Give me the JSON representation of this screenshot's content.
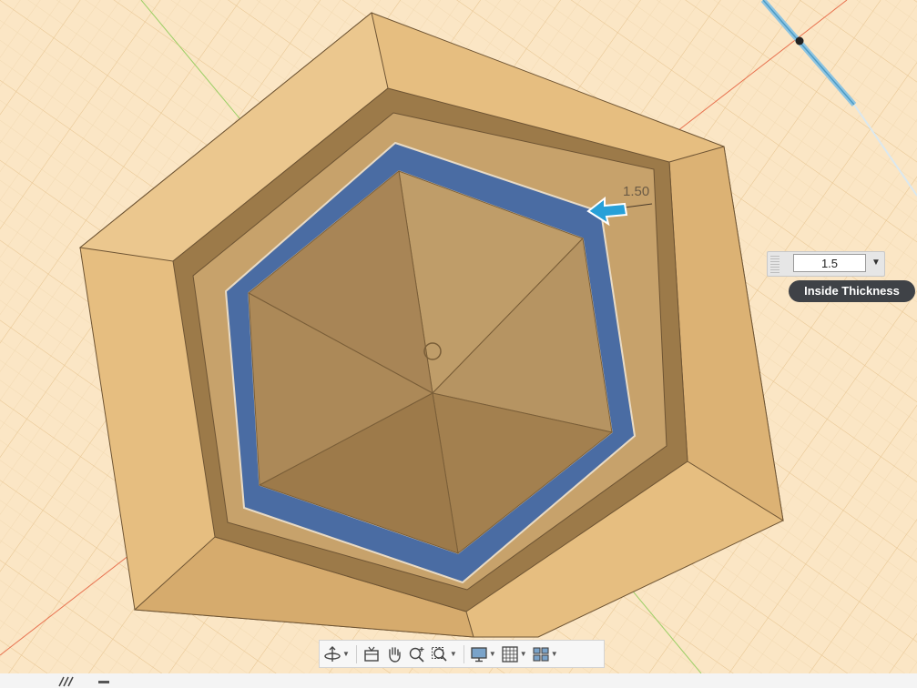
{
  "viewport": {
    "dimension_text": "1.50",
    "colors": {
      "background": "#fbe6c5",
      "grid": "#efd3a8",
      "outer_body": "#e6be80",
      "ledge": "#a07d4d",
      "shell_band": "#4a6ca3",
      "inner_floor": "#b18f5d",
      "x_axis": "#e8714f",
      "y_axis": "#9ccf66",
      "arrow": "#27a0d8"
    }
  },
  "thickness_input": {
    "value": "1.5",
    "tooltip": "Inside Thickness"
  },
  "nav_toolbar": {
    "tools": [
      {
        "id": "orbit",
        "icon": "orbit-icon",
        "has_menu": true
      },
      {
        "id": "look-at",
        "icon": "look-at-icon",
        "has_menu": false
      },
      {
        "id": "pan",
        "icon": "pan-hand-icon",
        "has_menu": false
      },
      {
        "id": "zoom",
        "icon": "zoom-icon",
        "has_menu": false
      },
      {
        "id": "zoom-window",
        "icon": "zoom-window-icon",
        "has_menu": true
      },
      {
        "id": "display-settings",
        "icon": "display-settings-icon",
        "has_menu": true
      },
      {
        "id": "grid-settings",
        "icon": "grid-icon",
        "has_menu": true
      },
      {
        "id": "viewports",
        "icon": "viewports-icon",
        "has_menu": true
      }
    ]
  }
}
